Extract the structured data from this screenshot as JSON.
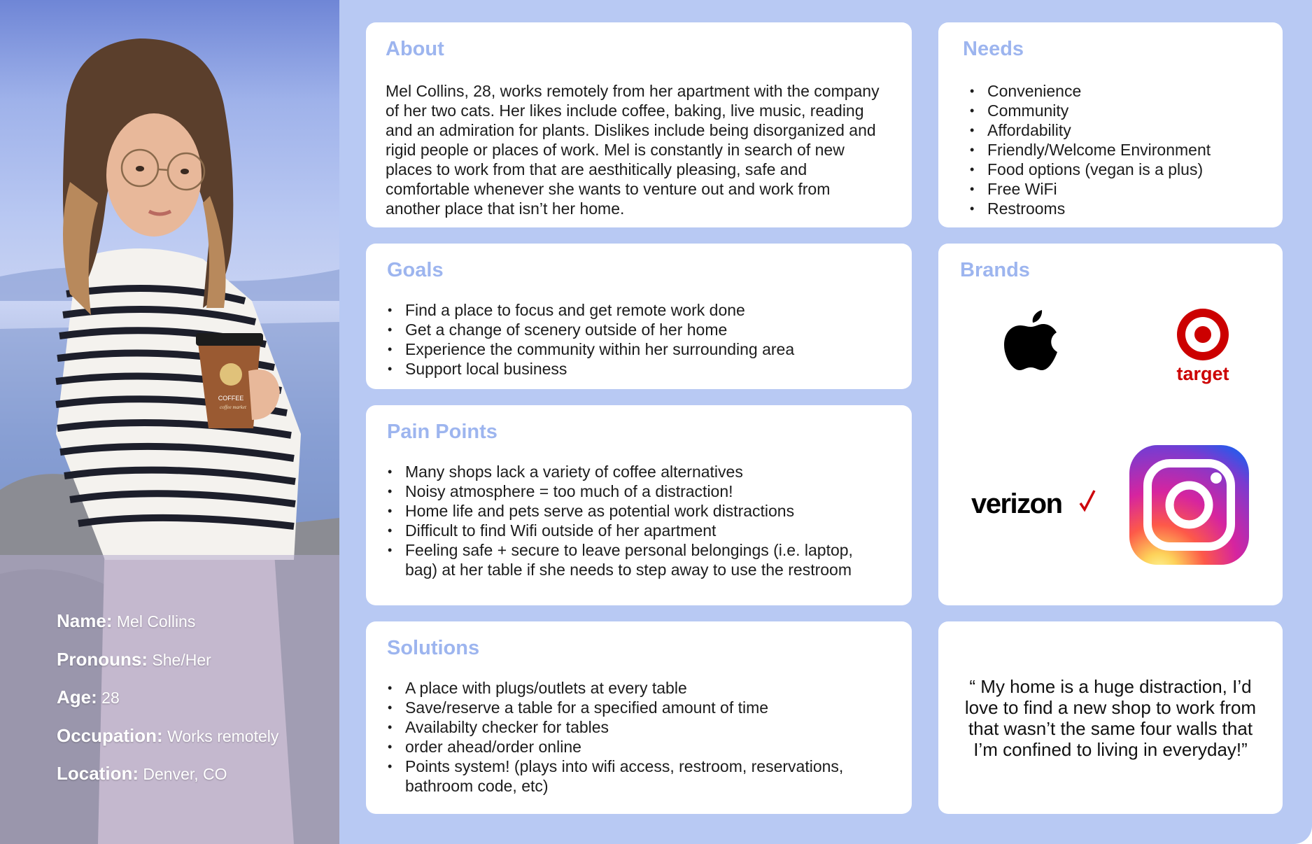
{
  "persona": {
    "name_label": "Name:",
    "name": "Mel Collins",
    "pronouns_label": "Pronouns:",
    "pronouns": "She/Her",
    "age_label": "Age:",
    "age": "28",
    "occupation_label": "Occupation:",
    "occupation": "Works remotely",
    "location_label": "Location:",
    "location": "Denver, CO",
    "cup_text": [
      "COFFEE",
      "coffee market"
    ]
  },
  "about": {
    "title": "About",
    "text": "Mel Collins, 28, works remotely from her apartment with the company of her two cats. Her likes include coffee, baking, live music, reading and an admiration for plants. Dislikes include being disorganized and rigid people or places of work. Mel is constantly in search of new places to work from that are aesthitically pleasing, safe and comfortable whenever she wants to venture out and work from another place that isn’t her home."
  },
  "needs": {
    "title": "Needs",
    "items": [
      "Convenience",
      "Community",
      "Affordability",
      "Friendly/Welcome Environment",
      "Food options (vegan is a plus)",
      "Free WiFi",
      "Restrooms"
    ]
  },
  "goals": {
    "title": "Goals",
    "items": [
      "Find a place to focus and get remote work done",
      "Get a change of scenery outside of her home",
      "Experience the community within her surrounding area",
      "Support local business"
    ]
  },
  "pain_points": {
    "title": "Pain Points",
    "items": [
      "Many shops lack a variety of coffee alternatives",
      "Noisy atmosphere = too much of a distraction!",
      "Home life and pets serve as potential work distractions",
      "Difficult to find Wifi outside of her apartment",
      "Feeling safe + secure to leave personal belongings (i.e. laptop, bag) at her table if she needs to step away to use the restroom"
    ]
  },
  "solutions": {
    "title": "Solutions",
    "items": [
      "A place with plugs/outlets at every table",
      "Save/reserve a table for a specified amount of time",
      "Availabilty checker for tables",
      "order ahead/order online",
      "Points system! (plays into wifi access, restroom, reservations, bathroom code, etc)"
    ]
  },
  "brands": {
    "title": "Brands",
    "logos": [
      {
        "name": "apple-logo",
        "text": ""
      },
      {
        "name": "target-logo",
        "text": "target"
      },
      {
        "name": "verizon-logo",
        "text": "verizon"
      },
      {
        "name": "instagram-logo",
        "text": ""
      }
    ],
    "colors": {
      "target": "#cc0000",
      "verizon_check": "#cd040b",
      "instagram_start": "#feda75",
      "instagram_end": "#4f5bd5"
    }
  },
  "quote": {
    "text": "“ My home is a huge distraction, I’d love to find a new shop to work from that wasn’t the same four walls that I’m confined to living in everyday!”"
  },
  "colors": {
    "background": "#b8c9f3",
    "card": "#ffffff",
    "heading": "#9db5ef",
    "body_text": "#1c1c1c"
  }
}
